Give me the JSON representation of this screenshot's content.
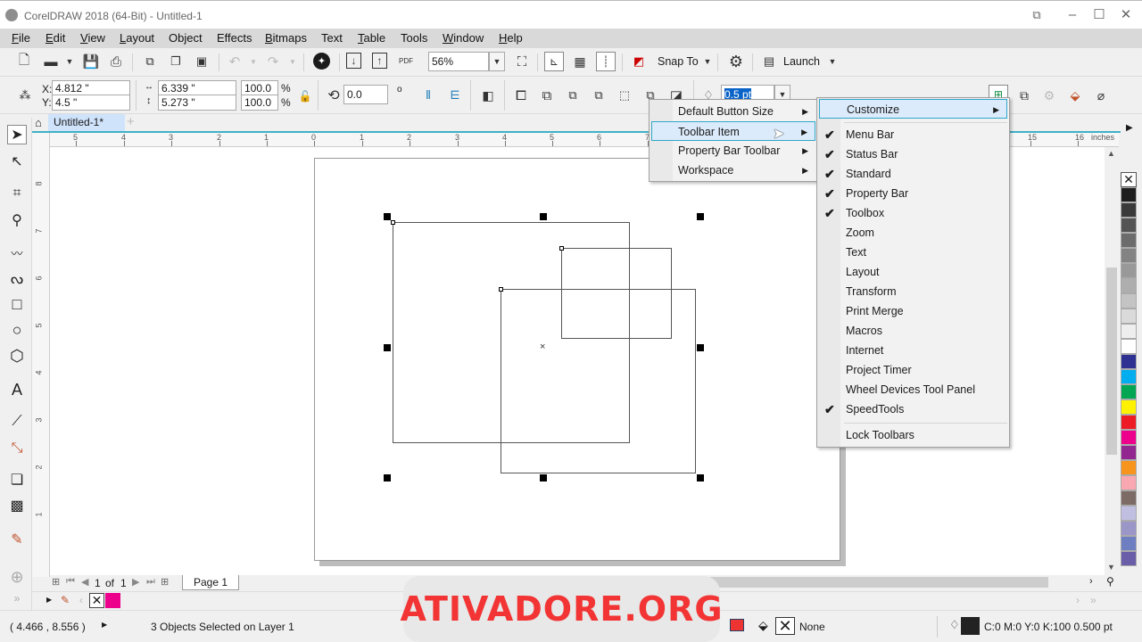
{
  "window": {
    "title": "CorelDRAW 2018 (64-Bit) - Untitled-1"
  },
  "menubar": [
    {
      "label": "File",
      "ul": "F",
      "rest": "ile"
    },
    {
      "label": "Edit",
      "ul": "E",
      "rest": "dit"
    },
    {
      "label": "View",
      "ul": "V",
      "rest": "iew"
    },
    {
      "label": "Layout",
      "ul": "L",
      "rest": "ayout"
    },
    {
      "label": "Object",
      "ul": "",
      "rest": "Object"
    },
    {
      "label": "Effects",
      "ul": "",
      "rest": "Effects"
    },
    {
      "label": "Bitmaps",
      "ul": "B",
      "rest": "itmaps"
    },
    {
      "label": "Text",
      "ul": "",
      "rest": "Text"
    },
    {
      "label": "Table",
      "ul": "T",
      "rest": "able"
    },
    {
      "label": "Tools",
      "ul": "",
      "rest": "Tools"
    },
    {
      "label": "Window",
      "ul": "W",
      "rest": "indow"
    },
    {
      "label": "Help",
      "ul": "H",
      "rest": "elp"
    }
  ],
  "standard_toolbar": {
    "zoom_level": "56%",
    "snap_to": "Snap To",
    "launch": "Launch",
    "pdf_label": "PDF"
  },
  "property_bar": {
    "x_label": "X:",
    "x_value": "4.812 \"",
    "y_label": "Y:",
    "y_value": "4.5 \"",
    "width_value": "6.339 \"",
    "height_value": "5.273 \"",
    "scale_w": "100.0",
    "scale_h": "100.0",
    "percent": "%",
    "rotation": "0.0",
    "degree": "o",
    "outline_width": "0.5 pt"
  },
  "document_tab": {
    "label": "Untitled-1*"
  },
  "ruler": {
    "h_ticks": [
      "5",
      "4",
      "3",
      "2",
      "1",
      "0",
      "1",
      "2",
      "3",
      "4",
      "5",
      "6",
      "7",
      "15",
      "16"
    ],
    "unit": "inches",
    "v_ticks": [
      "8",
      "7",
      "6",
      "5",
      "4",
      "3",
      "2",
      "1"
    ]
  },
  "context_menu": {
    "items": [
      {
        "label": "Default Button Size"
      },
      {
        "label": "Toolbar Item"
      },
      {
        "label": "Property Bar Toolbar"
      },
      {
        "label": "Workspace"
      }
    ]
  },
  "submenu": {
    "customize": "Customize",
    "items": [
      {
        "label": "Menu Bar",
        "checked": true
      },
      {
        "label": "Status Bar",
        "checked": true
      },
      {
        "label": "Standard",
        "checked": true
      },
      {
        "label": "Property Bar",
        "checked": true
      },
      {
        "label": "Toolbox",
        "checked": true
      },
      {
        "label": "Zoom",
        "checked": false
      },
      {
        "label": "Text",
        "checked": false
      },
      {
        "label": "Layout",
        "checked": false
      },
      {
        "label": "Transform",
        "checked": false
      },
      {
        "label": "Print Merge",
        "checked": false
      },
      {
        "label": "Macros",
        "checked": false
      },
      {
        "label": "Internet",
        "checked": false
      },
      {
        "label": "Project Timer",
        "checked": false
      },
      {
        "label": "Wheel Devices Tool Panel",
        "checked": false
      },
      {
        "label": "SpeedTools",
        "checked": true
      }
    ],
    "lock": "Lock Toolbars",
    "check_glyph": "✔"
  },
  "page_nav": {
    "current": "1",
    "of": "of",
    "total": "1",
    "page_tab": "Page 1"
  },
  "palette": {
    "colors": [
      "#1e1e1e",
      "#3a3a3a",
      "#545454",
      "#6c6c6c",
      "#838383",
      "#999999",
      "#aeaeae",
      "#c4c4c4",
      "#dadada",
      "#eeeeee",
      "#ffffff",
      "#2e3192",
      "#00aeef",
      "#00a651",
      "#fff200",
      "#ed1c24",
      "#ec008c",
      "#92278f",
      "#f7941d",
      "#f9a7b0",
      "#7d6b65",
      "#c1bfe1",
      "#9b96c8",
      "#6d7ec1",
      "#6a5ea8"
    ]
  },
  "doc_palette": {
    "colors": [
      "#ec008c"
    ]
  },
  "status": {
    "coords": "( 4.466 , 8.556 )",
    "selection": "3 Objects Selected on Layer 1",
    "fill": "None",
    "outline": "C:0 M:0 Y:0 K:100  0.500 pt"
  },
  "watermark": "ATIVADORE.ORG"
}
